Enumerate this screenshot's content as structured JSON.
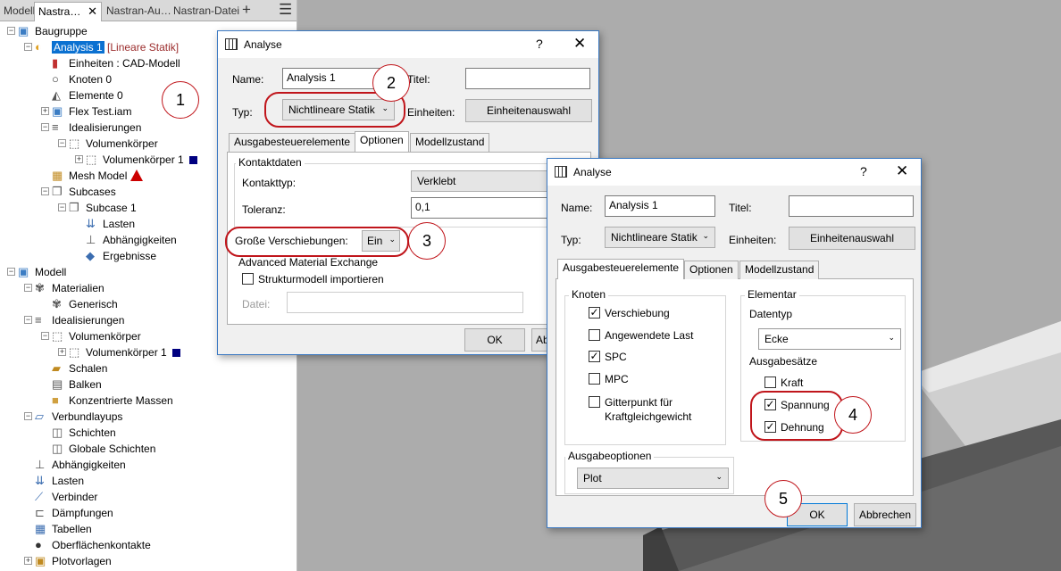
{
  "tabs": [
    "Modell",
    "Nastra…",
    "Nastran-Au…",
    "Nastran-Datei"
  ],
  "tree": [
    {
      "t": "Baugruppe",
      "i": "assembly-icon",
      "l": 0,
      "e": "-"
    },
    {
      "t": "Analysis 1",
      "s": " [Lineare Statik]",
      "i": "analysis-icon",
      "l": 1,
      "e": "-",
      "sel": true
    },
    {
      "t": "Einheiten : CAD-Modell",
      "i": "units-icon",
      "l": 2
    },
    {
      "t": "Knoten 0",
      "i": "node-icon",
      "l": 2
    },
    {
      "t": "Elemente 0",
      "i": "element-icon",
      "l": 2
    },
    {
      "t": "Flex Test.iam",
      "i": "assembly-icon",
      "l": 2,
      "e": "+"
    },
    {
      "t": "Idealisierungen",
      "i": "idealization-icon",
      "l": 2,
      "e": "-"
    },
    {
      "t": "Volumenkörper",
      "i": "solid-icon",
      "l": 3,
      "e": "-"
    },
    {
      "t": "Volumenkörper 1",
      "i": "solid-icon",
      "l": 4,
      "e": "+",
      "dot": true
    },
    {
      "t": "Mesh Model",
      "i": "mesh-icon",
      "l": 2,
      "warn": true
    },
    {
      "t": "Subcases",
      "i": "subcase-icon",
      "l": 2,
      "e": "-"
    },
    {
      "t": "Subcase 1",
      "i": "subcase-icon",
      "l": 3,
      "e": "-"
    },
    {
      "t": "Lasten",
      "i": "load-icon",
      "l": 4
    },
    {
      "t": "Abhängigkeiten",
      "i": "constraint-icon",
      "l": 4
    },
    {
      "t": "Ergebnisse",
      "i": "results-icon",
      "l": 4
    },
    {
      "t": "Modell",
      "i": "model-icon",
      "l": 0,
      "e": "-"
    },
    {
      "t": "Materialien",
      "i": "material-icon",
      "l": 1,
      "e": "-"
    },
    {
      "t": "Generisch",
      "i": "material-icon",
      "l": 2
    },
    {
      "t": "Idealisierungen",
      "i": "idealization-icon",
      "l": 1,
      "e": "-"
    },
    {
      "t": "Volumenkörper",
      "i": "solid-icon",
      "l": 2,
      "e": "-"
    },
    {
      "t": "Volumenkörper 1",
      "i": "solid-icon",
      "l": 3,
      "e": "+",
      "dot": true
    },
    {
      "t": "Schalen",
      "i": "shell-icon",
      "l": 2
    },
    {
      "t": "Balken",
      "i": "beam-icon",
      "l": 2
    },
    {
      "t": "Konzentrierte Massen",
      "i": "mass-icon",
      "l": 2
    },
    {
      "t": "Verbundlayups",
      "i": "layup-icon",
      "l": 1,
      "e": "-"
    },
    {
      "t": "Schichten",
      "i": "layer-icon",
      "l": 2
    },
    {
      "t": "Globale Schichten",
      "i": "layer-icon",
      "l": 2
    },
    {
      "t": "Abhängigkeiten",
      "i": "constraint-icon",
      "l": 1
    },
    {
      "t": "Lasten",
      "i": "load-icon",
      "l": 1
    },
    {
      "t": "Verbinder",
      "i": "connector-icon",
      "l": 1
    },
    {
      "t": "Dämpfungen",
      "i": "damper-icon",
      "l": 1
    },
    {
      "t": "Tabellen",
      "i": "table-icon",
      "l": 1
    },
    {
      "t": "Oberflächenkontakte",
      "i": "contact-icon",
      "l": 1
    },
    {
      "t": "Plotvorlagen",
      "i": "plot-icon",
      "l": 1,
      "e": "+"
    }
  ],
  "d1": {
    "title": "Analyse",
    "q": "?",
    "close": "✕",
    "name_label": "Name:",
    "name_value": "Analysis 1",
    "titel_label": "Titel:",
    "typ_label": "Typ:",
    "typ_value": "Nichtlineare Statik",
    "einheiten_label": "Einheiten:",
    "einheiten_btn": "Einheitenauswahl",
    "tabs": [
      "Ausgabesteuerelemente",
      "Optionen",
      "Modellzustand"
    ],
    "kontaktdaten": "Kontaktdaten",
    "kontakttyp_label": "Kontakttyp:",
    "kontakttyp_value": "Verklebt",
    "toleranz_label": "Toleranz:",
    "toleranz_value": "0,1",
    "gv_label": "Große Verschiebungen:",
    "gv_value": "Ein",
    "ame": "Advanced Material Exchange",
    "struktur": "Strukturmodell importieren",
    "datei_label": "Datei:",
    "ok": "OK",
    "abbrechen": "Ab"
  },
  "d2": {
    "title": "Analyse",
    "q": "?",
    "close": "✕",
    "name_label": "Name:",
    "name_value": "Analysis 1",
    "titel_label": "Titel:",
    "typ_label": "Typ:",
    "typ_value": "Nichtlineare Statik",
    "einheiten_label": "Einheiten:",
    "einheiten_btn": "Einheitenauswahl",
    "tabs": [
      "Ausgabesteuerelemente",
      "Optionen",
      "Modellzustand"
    ],
    "knoten": "Knoten",
    "verschiebung": "Verschiebung",
    "angewendete": "Angewendete Last",
    "spc": "SPC",
    "mpc": "MPC",
    "gitter1": "Gitterpunkt für",
    "gitter2": "Kraftgleichgewicht",
    "elementar": "Elementar",
    "datentyp": "Datentyp",
    "ecke": "Ecke",
    "ausgabesaetze": "Ausgabesätze",
    "kraft": "Kraft",
    "spannung": "Spannung",
    "dehnung": "Dehnung",
    "ausgabeoptionen": "Ausgabeoptionen",
    "plot": "Plot",
    "ok": "OK",
    "abbrechen": "Abbrechen"
  },
  "callouts": [
    "1",
    "2",
    "3",
    "4",
    "5"
  ]
}
